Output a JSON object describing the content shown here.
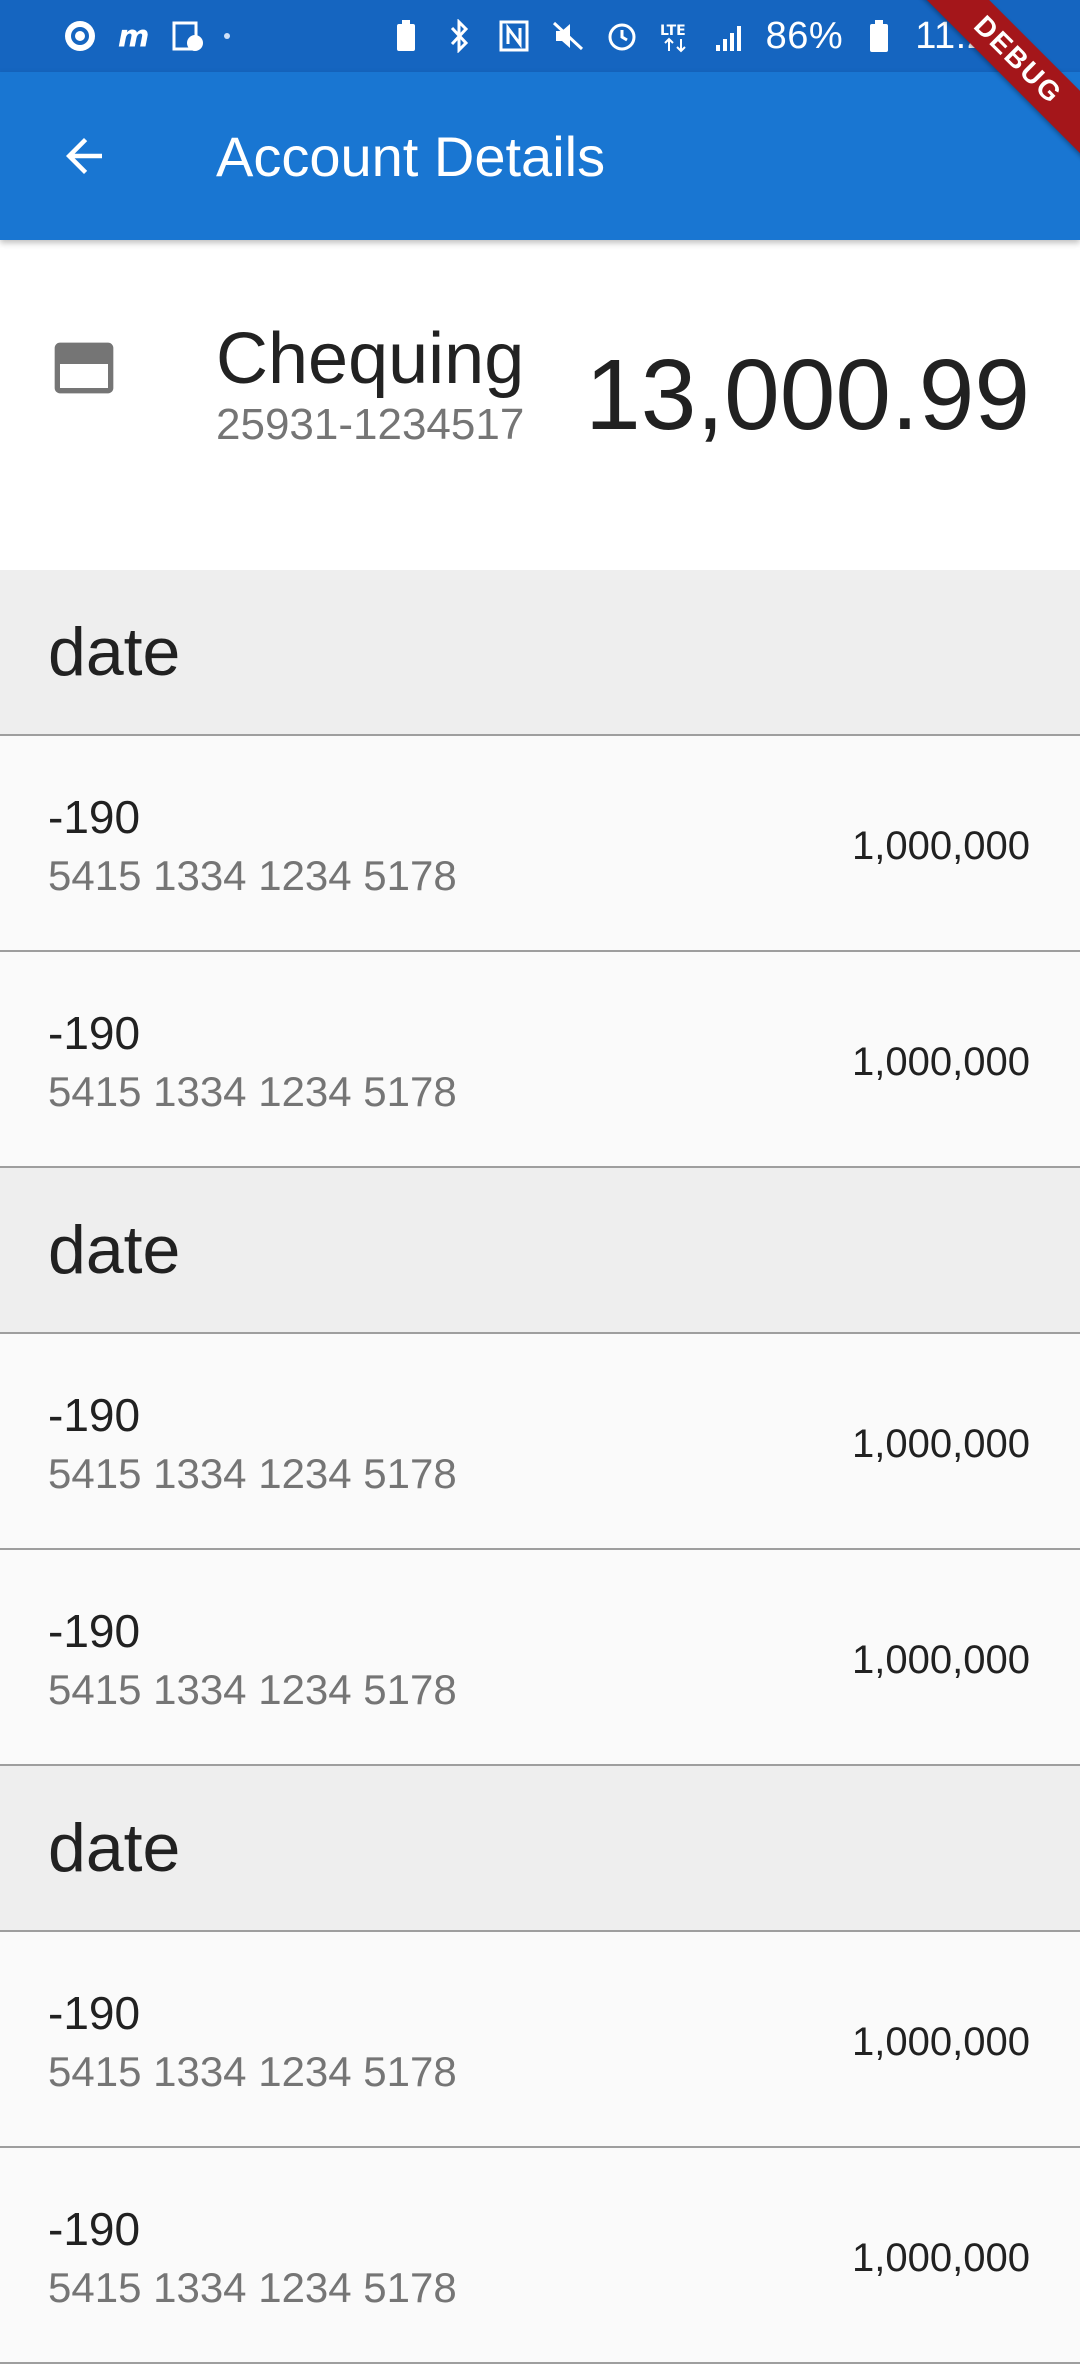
{
  "status_bar": {
    "battery": "86%",
    "time": "11:29",
    "left_icons": [
      "sync-icon",
      "m-app-icon",
      "calendar-clock-icon"
    ],
    "right_icons": [
      "battery-saver-icon",
      "bluetooth-icon",
      "nfc-icon",
      "mute-icon",
      "alarm-icon",
      "lte-icon",
      "signal-icon",
      "battery-icon"
    ]
  },
  "debug_banner": "DEBUG",
  "app_bar": {
    "title": "Account Details",
    "back_icon": "arrow-back-icon"
  },
  "account": {
    "name": "Chequing",
    "number": "25931-1234517",
    "balance": "13,000.99",
    "icon": "credit-card-icon"
  },
  "groups": [
    {
      "date": "date",
      "transactions": [
        {
          "amount": "-190",
          "card": "5415 1334 1234 5178",
          "value": "1,000,000"
        },
        {
          "amount": "-190",
          "card": "5415 1334 1234 5178",
          "value": "1,000,000"
        }
      ]
    },
    {
      "date": "date",
      "transactions": [
        {
          "amount": "-190",
          "card": "5415 1334 1234 5178",
          "value": "1,000,000"
        },
        {
          "amount": "-190",
          "card": "5415 1334 1234 5178",
          "value": "1,000,000"
        }
      ]
    },
    {
      "date": "date",
      "transactions": [
        {
          "amount": "-190",
          "card": "5415 1334 1234 5178",
          "value": "1,000,000"
        },
        {
          "amount": "-190",
          "card": "5415 1334 1234 5178",
          "value": "1,000,000"
        }
      ]
    }
  ],
  "colors": {
    "app_bar": "#1976d2",
    "status_bar": "#1565c0",
    "date_header_bg": "#eeeeee",
    "debug_banner": "#a4161a"
  }
}
